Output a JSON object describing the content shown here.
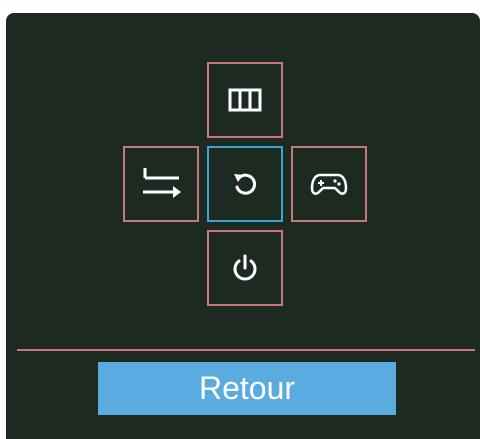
{
  "menu": {
    "up": {
      "icon": "picture-mode-icon"
    },
    "left": {
      "icon": "input-source-icon"
    },
    "center": {
      "icon": "return-icon"
    },
    "right": {
      "icon": "game-mode-icon"
    },
    "down": {
      "icon": "power-icon"
    }
  },
  "footer": {
    "back_label": "Retour"
  },
  "colors": {
    "panel_background": "#1c2a22",
    "tile_border": "#c9777a",
    "selected_border": "#3aa6d8",
    "button_background": "#5aabe0",
    "icon_color": "#ffffff"
  }
}
